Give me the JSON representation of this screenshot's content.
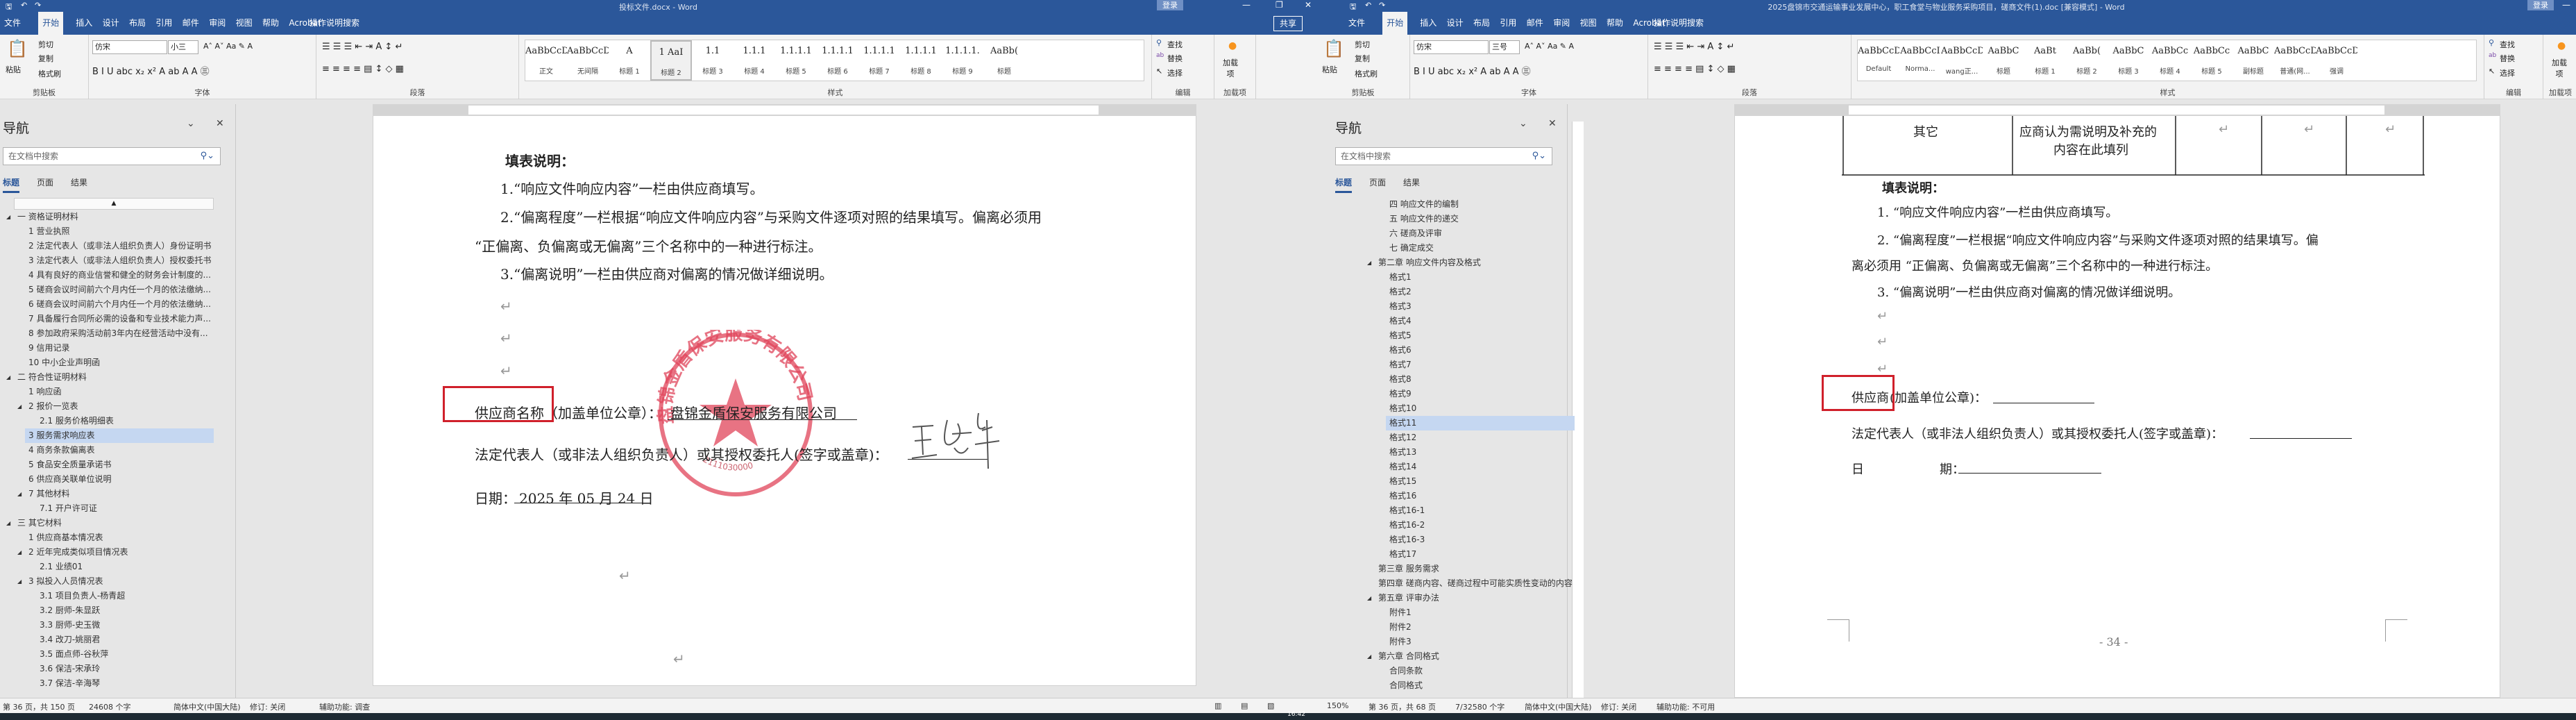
{
  "windows": [
    {
      "id": "left",
      "title": "投标文件.docx - Word",
      "login": "登录",
      "share": "共享",
      "tabs": [
        "文件",
        "开始",
        "插入",
        "设计",
        "布局",
        "引用",
        "邮件",
        "审阅",
        "视图",
        "帮助",
        "Acrobat"
      ],
      "active_tab": 1,
      "tell_me": "操作说明搜索",
      "clipboard": {
        "paste": "粘贴",
        "cut": "剪切",
        "copy": "复制",
        "format_painter": "格式刷",
        "group": "剪贴板"
      },
      "font": {
        "name": "仿宋",
        "size": "小三",
        "group": "字体"
      },
      "paragraph": {
        "group": "段落"
      },
      "styles": {
        "group": "样式",
        "selected": 3,
        "items": [
          {
            "preview": "AaBbCcDd",
            "label": "正文"
          },
          {
            "preview": "AaBbCcDd",
            "label": "无间隔"
          },
          {
            "preview": "A",
            "label": "标题 1"
          },
          {
            "preview": "1  AaI",
            "label": "标题 2"
          },
          {
            "preview": "1.1",
            "label": "标题 3"
          },
          {
            "preview": "1.1.1",
            "label": "标题 4"
          },
          {
            "preview": "1.1.1.1",
            "label": "标题 5"
          },
          {
            "preview": "1.1.1.1",
            "label": "标题 6"
          },
          {
            "preview": "1.1.1.1",
            "label": "标题 7"
          },
          {
            "preview": "1.1.1.1",
            "label": "标题 8"
          },
          {
            "preview": "1.1.1.1.",
            "label": "标题 9"
          },
          {
            "preview": "AaBb(",
            "label": "标题"
          }
        ]
      },
      "editing": {
        "find": "查找",
        "replace": "替换",
        "select": "选择",
        "group": "编辑"
      },
      "addins": {
        "label": "加载项",
        "group": "加载项"
      },
      "nav": {
        "title": "导航",
        "search_placeholder": "在文档中搜索",
        "tabs": [
          "标题",
          "页面",
          "结果"
        ],
        "items": [
          {
            "text": "一 资格证明材料",
            "level": 1,
            "expanded": true
          },
          {
            "text": "1 营业执照",
            "level": 2
          },
          {
            "text": "2 法定代表人（或非法人组织负责人）身份证明书",
            "level": 2
          },
          {
            "text": "3 法定代表人（或非法人组织负责人）授权委托书",
            "level": 2
          },
          {
            "text": "4 具有良好的商业信誉和健全的财务会计制度的...",
            "level": 2
          },
          {
            "text": "5 磋商会议时间前六个月内任一个月的依法缴纳...",
            "level": 2
          },
          {
            "text": "6 磋商会议时间前六个月内任一个月的依法缴纳...",
            "level": 2
          },
          {
            "text": "7 具备履行合同所必需的设备和专业技术能力声...",
            "level": 2
          },
          {
            "text": "8 参加政府采购活动前3年内在经营活动中没有...",
            "level": 2
          },
          {
            "text": "9 信用记录",
            "level": 2
          },
          {
            "text": "10 中小企业声明函",
            "level": 2
          },
          {
            "text": "二 符合性证明材料",
            "level": 1,
            "expanded": true
          },
          {
            "text": "1 响应函",
            "level": 2
          },
          {
            "text": "2 报价一览表",
            "level": 2,
            "expanded": true
          },
          {
            "text": "2.1 服务价格明细表",
            "level": 3
          },
          {
            "text": "3 服务需求响应表",
            "level": 2,
            "selected": true
          },
          {
            "text": "4 商务条款偏离表",
            "level": 2
          },
          {
            "text": "5  食品安全质量承诺书",
            "level": 2
          },
          {
            "text": "6 供应商关联单位说明",
            "level": 2
          },
          {
            "text": "7 其他材料",
            "level": 2,
            "expanded": true
          },
          {
            "text": "7.1 开户许可证",
            "level": 3
          },
          {
            "text": "三 其它材料",
            "level": 1,
            "expanded": true
          },
          {
            "text": "1 供应商基本情况表",
            "level": 2
          },
          {
            "text": "2 近年完成类似项目情况表",
            "level": 2,
            "expanded": true
          },
          {
            "text": "2.1 业绩01",
            "level": 3
          },
          {
            "text": "3 拟投入人员情况表",
            "level": 2,
            "expanded": true
          },
          {
            "text": "3.1 项目负责人-杨青超",
            "level": 3
          },
          {
            "text": "3.2 厨师-朱显跃",
            "level": 3
          },
          {
            "text": "3.3 厨师-史玉微",
            "level": 3
          },
          {
            "text": "3.4 改刀-姚丽君",
            "level": 3
          },
          {
            "text": "3.5 面点师-谷秋萍",
            "level": 3
          },
          {
            "text": "3.6 保洁-宋承玲",
            "level": 3
          },
          {
            "text": "3.7 保洁-辛海琴",
            "level": 3
          }
        ]
      },
      "status": [
        "第 36 页，共 150 页",
        "24608 个字",
        "简体中文(中国大陆)",
        "修订: 关闭",
        "辅助功能: 调查"
      ]
    },
    {
      "id": "right",
      "title": "2025盘锦市交通运输事业发展中心，职工食堂与物业服务采购项目，磋商文件(1).doc [兼容模式] - Word",
      "login": "登录",
      "tabs": [
        "文件",
        "开始",
        "插入",
        "设计",
        "布局",
        "引用",
        "邮件",
        "审阅",
        "视图",
        "帮助",
        "Acrobat"
      ],
      "active_tab": 1,
      "tell_me": "操作说明搜索",
      "clipboard": {
        "paste": "粘贴",
        "cut": "剪切",
        "copy": "复制",
        "format_painter": "格式刷",
        "group": "剪贴板"
      },
      "font": {
        "name": "仿宋",
        "size": "三号",
        "group": "字体"
      },
      "paragraph": {
        "group": "段落"
      },
      "styles": {
        "group": "样式",
        "selected": -1,
        "items": [
          {
            "preview": "AaBbCcDc",
            "label": "Default"
          },
          {
            "preview": "AaBbCcI",
            "label": "Norma..."
          },
          {
            "preview": "AaBbCcDd",
            "label": "wang正..."
          },
          {
            "preview": "AaBbC",
            "label": "标题"
          },
          {
            "preview": "AaBt",
            "label": "标题 1"
          },
          {
            "preview": "AaBb(",
            "label": "标题 2"
          },
          {
            "preview": "AaBbC",
            "label": "标题 3"
          },
          {
            "preview": "AaBbCc",
            "label": "标题 4"
          },
          {
            "preview": "AaBbCc",
            "label": "标题 5"
          },
          {
            "preview": "AaBbC",
            "label": "副标题"
          },
          {
            "preview": "AaBbCcD",
            "label": "普通(网..."
          },
          {
            "preview": "AaBbCcDd",
            "label": "强调"
          }
        ]
      },
      "editing": {
        "find": "查找",
        "replace": "替换",
        "select": "选择",
        "group": "编辑"
      },
      "addins": {
        "label": "加载项",
        "group": "加载项"
      },
      "nav": {
        "title": "导航",
        "search_placeholder": "在文档中搜索",
        "tabs": [
          "标题",
          "页面",
          "结果"
        ],
        "items": [
          {
            "text": "四  响应文件的编制",
            "level": 2
          },
          {
            "text": "五 响应文件的递交",
            "level": 2
          },
          {
            "text": "六 磋商及评审",
            "level": 2
          },
          {
            "text": "七 确定成交",
            "level": 2
          },
          {
            "text": "第二章 响应文件内容及格式",
            "level": 1,
            "expanded": true
          },
          {
            "text": "格式1",
            "level": 2
          },
          {
            "text": "格式2",
            "level": 2
          },
          {
            "text": "格式3",
            "level": 2
          },
          {
            "text": "格式4",
            "level": 2
          },
          {
            "text": "格式5",
            "level": 2
          },
          {
            "text": "格式6",
            "level": 2
          },
          {
            "text": "格式7",
            "level": 2
          },
          {
            "text": "格式8",
            "level": 2
          },
          {
            "text": "格式9",
            "level": 2
          },
          {
            "text": "格式10",
            "level": 2
          },
          {
            "text": "格式11",
            "level": 2,
            "selected": true
          },
          {
            "text": "格式12",
            "level": 2
          },
          {
            "text": "格式13",
            "level": 2
          },
          {
            "text": "格式14",
            "level": 2
          },
          {
            "text": "格式15",
            "level": 2
          },
          {
            "text": "格式16",
            "level": 2
          },
          {
            "text": "格式16-1",
            "level": 2
          },
          {
            "text": "格式16-2",
            "level": 2
          },
          {
            "text": "格式16-3",
            "level": 2
          },
          {
            "text": "格式17",
            "level": 2
          },
          {
            "text": "第三章  服务需求",
            "level": 1
          },
          {
            "text": "第四章 磋商内容、磋商过程中可能实质性变动的内容",
            "level": 1
          },
          {
            "text": "第五章 评审办法",
            "level": 1,
            "expanded": true
          },
          {
            "text": "附件1",
            "level": 2
          },
          {
            "text": "附件2",
            "level": 2
          },
          {
            "text": "附件3",
            "level": 2
          },
          {
            "text": "第六章 合同格式",
            "level": 1,
            "expanded": true
          },
          {
            "text": "合同条款",
            "level": 2
          },
          {
            "text": "合同格式",
            "level": 2
          }
        ]
      },
      "status": [
        "150%",
        "第 36 页，共 68 页",
        "7/32580 个字",
        "简体中文(中国大陆)",
        "修订: 关闭",
        "辅助功能: 不可用"
      ]
    }
  ],
  "left_doc": {
    "heading": "填表说明：",
    "item1": "1.“响应文件响应内容”一栏由供应商填写。",
    "item2": "2.“偏离程度”一栏根据“响应文件响应内容”与采购文件逐项对照的结果填写。偏离必须用",
    "item2_cont": "“正偏离、负偏离或无偏离”三个名称中的一种进行标注。",
    "item3": "3.“偏离说明”一栏由供应商对偏离的情况做详细说明。",
    "supplier_label": "供应商名称（加盖单位公章）：",
    "supplier_value": "盘锦金盾保安服务有限公司",
    "legal_label": "法定代表人（或非法人组织负责人）或其授权委托人(签字或盖章)：",
    "date_label": "日期：",
    "date_value": "2025 年 05 月 24 日",
    "stamp_text": "盘锦金盾保安服务有限公司",
    "stamp_number": "2111030000",
    "return_mark": "↵"
  },
  "right_doc": {
    "table_row": {
      "col1": "其它",
      "col2_line1": "应商认为需说明及补充的",
      "col2_line2": "内容在此填列"
    },
    "heading": "填表说明：",
    "item1": "1. “响应文件响应内容”一栏由供应商填写。",
    "item2": "2. “偏离程度”一栏根据“响应文件响应内容”与采购文件逐项对照的结果填写。偏",
    "item2_cont": "离必须用 “正偏离、负偏离或无偏离”三个名称中的一种进行标注。",
    "item3": "3. “偏离说明”一栏由供应商对偏离的情况做详细说明。",
    "supplier_label": "供应商",
    "supplier_rest": "(加盖单位公章)：",
    "legal_label": "法定代表人（或非法人组织负责人）或其授权委托人(签字或盖章)：",
    "date_char1": "日",
    "date_char2": "期：",
    "page_number": "- 34 -",
    "return_mark": "↵"
  },
  "taskbar": {
    "time": "16:42"
  }
}
